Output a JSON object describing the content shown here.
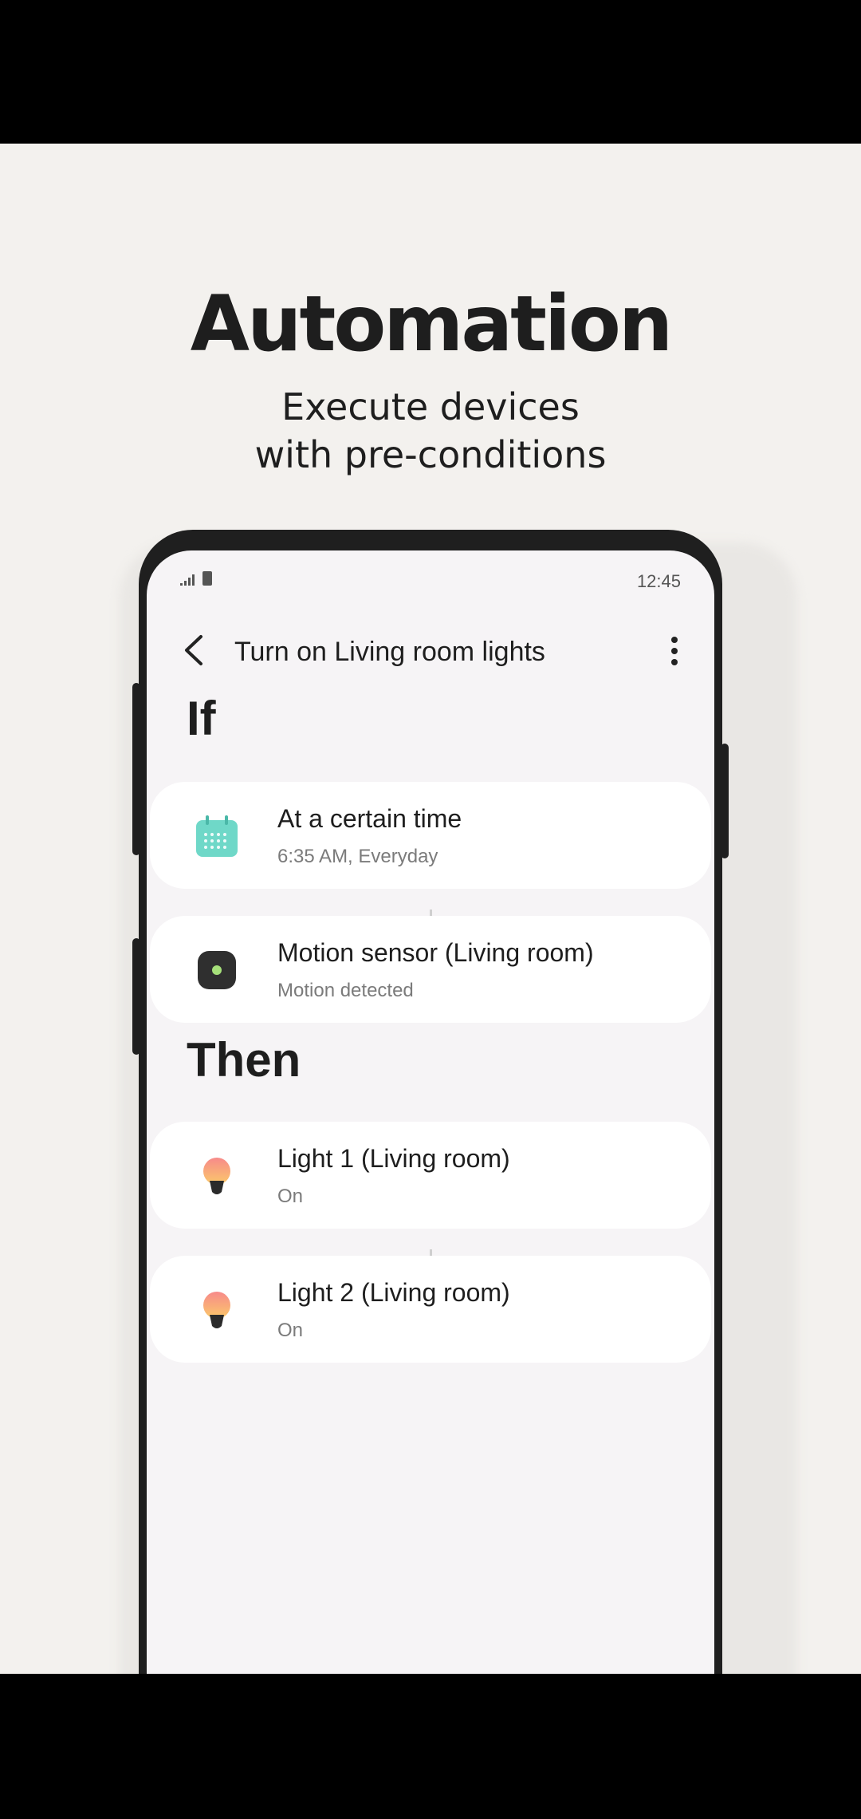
{
  "promo": {
    "headline": "Automation",
    "subhead_line1": "Execute devices",
    "subhead_line2": "with pre-conditions"
  },
  "status_bar": {
    "time": "12:45"
  },
  "app_bar": {
    "title": "Turn on Living room lights"
  },
  "conditions": {
    "label": "If",
    "items": [
      {
        "title": "At a certain time",
        "subtitle": "6:35 AM, Everyday",
        "icon": "calendar-icon"
      },
      {
        "title": "Motion sensor (Living room)",
        "subtitle": "Motion detected",
        "icon": "motion-sensor-icon"
      }
    ]
  },
  "actions": {
    "label": "Then",
    "items": [
      {
        "title": "Light 1 (Living room)",
        "subtitle": "On",
        "icon": "light-bulb-icon"
      },
      {
        "title": "Light 2 (Living room)",
        "subtitle": "On",
        "icon": "light-bulb-icon"
      }
    ]
  },
  "colors": {
    "calendar_teal": "#6fd8c8",
    "sensor_dark": "#2f2f2f",
    "sensor_led": "#a6e07a",
    "bulb_peach": "#f7a27c"
  }
}
